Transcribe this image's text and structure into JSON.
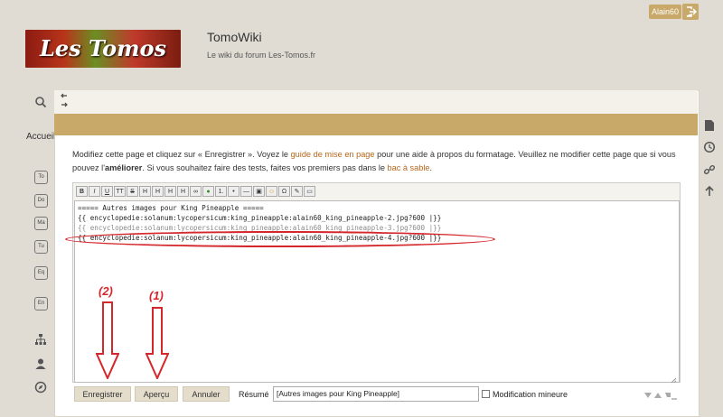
{
  "user": {
    "name": "Alain60"
  },
  "header": {
    "logo_text": "Les Tomos",
    "title": "TomoWiki",
    "subtitle": "Le wiki du forum Les-Tomos.fr"
  },
  "sidebar": {
    "home_label": "Accueil",
    "boxes": [
      "To",
      "Do",
      "Ma",
      "Tu",
      "Eq",
      "En"
    ]
  },
  "intro": {
    "part1": "Modifiez cette page et cliquez sur « Enregistrer ». Voyez le ",
    "link1": "guide de mise en page",
    "part2": " pour une aide à propos du formatage. Veuillez ne modifier cette page que si vous pouvez l'",
    "bold": "améliorer",
    "part3": ". Si vous souhaitez faire des tests, faites vos premiers pas dans le ",
    "link2": "bac à sable",
    "part4": "."
  },
  "toolbar": [
    "B",
    "I",
    "U",
    "TT",
    "S",
    "H",
    "H",
    "H",
    "H",
    "∞",
    "●",
    "1.",
    "•",
    "—",
    "▣",
    "☺",
    "Ω",
    "✎",
    "▭"
  ],
  "editor": {
    "lines": [
      "===== Autres images pour King Pineapple =====",
      "{{ encyclopedie:solanum:lycopersicum:king_pineapple:alain60_king_pineapple-2.jpg?600 |}}",
      "{{ encyclopedie:solanum:lycopersicum:king_pineapple:alain60_king_pineapple-3.jpg?600 |}}",
      "{{ encyclopedie:solanum:lycopersicum:king_pineapple:alain60_king_pineapple-4.jpg?600 |}}"
    ]
  },
  "annotations": {
    "a": "(2)",
    "b": "(1)"
  },
  "buttons": {
    "save": "Enregistrer",
    "preview": "Aperçu",
    "cancel": "Annuler"
  },
  "summary": {
    "label": "Résumé",
    "value": "[Autres images pour King Pineapple]"
  },
  "minor": {
    "label": "Modification mineure"
  },
  "colors": {
    "accent": "#c8a96a",
    "link": "#b5671d",
    "annotation": "#d4262b"
  }
}
